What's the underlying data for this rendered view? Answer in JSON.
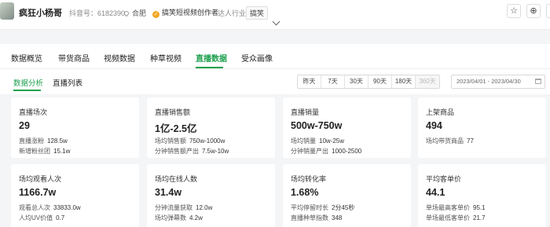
{
  "header": {
    "name": "疯狂小杨哥",
    "account_label": "抖音号：6182390",
    "location": "合肥",
    "creator_badge": "搞笑短视频创作者",
    "industry_label": "达人行业",
    "industry_value": "搞笑",
    "buttons": [
      "☆",
      "⊕",
      "↻"
    ]
  },
  "tabs": {
    "items": [
      "数据概览",
      "带货商品",
      "视频数据",
      "种草视频",
      "直播数据",
      "受众画像"
    ],
    "active": "直播数据"
  },
  "subnav": {
    "items": [
      "数据分析",
      "直播列表"
    ],
    "active": "数据分析",
    "ranges": [
      "昨天",
      "7天",
      "30天",
      "90天",
      "180天",
      "360天"
    ],
    "date_range": "2023/04/01  -  2023/04/30"
  },
  "cards": [
    {
      "title": "直播场次",
      "value": "29",
      "rows": [
        {
          "label": "直播涨粉",
          "value": "128.5w"
        },
        {
          "label": "新增粉丝团",
          "value": "15.1w"
        }
      ]
    },
    {
      "title": "直播销售额",
      "value": "1亿-2.5亿",
      "rows": [
        {
          "label": "场均销售额",
          "value": "750w-1000w"
        },
        {
          "label": "分钟销售额产出",
          "value": "7.5w-10w"
        }
      ]
    },
    {
      "title": "直播销量",
      "value": "500w-750w",
      "rows": [
        {
          "label": "场均销量",
          "value": "10w-25w"
        },
        {
          "label": "分钟销量产出",
          "value": "1000-2500"
        }
      ]
    },
    {
      "title": "上架商品",
      "value": "494",
      "rows": [
        {
          "label": "场均带货商品",
          "value": "77"
        }
      ]
    },
    {
      "title": "场均观看人次",
      "value": "1166.7w",
      "rows": [
        {
          "label": "观看总人次",
          "value": "33833.0w"
        },
        {
          "label": "人均UV价值",
          "value": "0.7"
        }
      ]
    },
    {
      "title": "场均在线人数",
      "value": "31.4w",
      "rows": [
        {
          "label": "分钟流量获取",
          "value": "12.0w"
        },
        {
          "label": "场均弹幕数",
          "value": "4.2w"
        }
      ]
    },
    {
      "title": "场均转化率",
      "value": "1.68%",
      "rows": [
        {
          "label": "平均停留时长",
          "value": "2分45秒"
        },
        {
          "label": "直播种草指数",
          "value": "348"
        }
      ]
    },
    {
      "title": "平均客单价",
      "value": "44.1",
      "rows": [
        {
          "label": "单场最高客单价",
          "value": "95.1"
        },
        {
          "label": "单场最低客单价",
          "value": "21.7"
        }
      ]
    }
  ]
}
